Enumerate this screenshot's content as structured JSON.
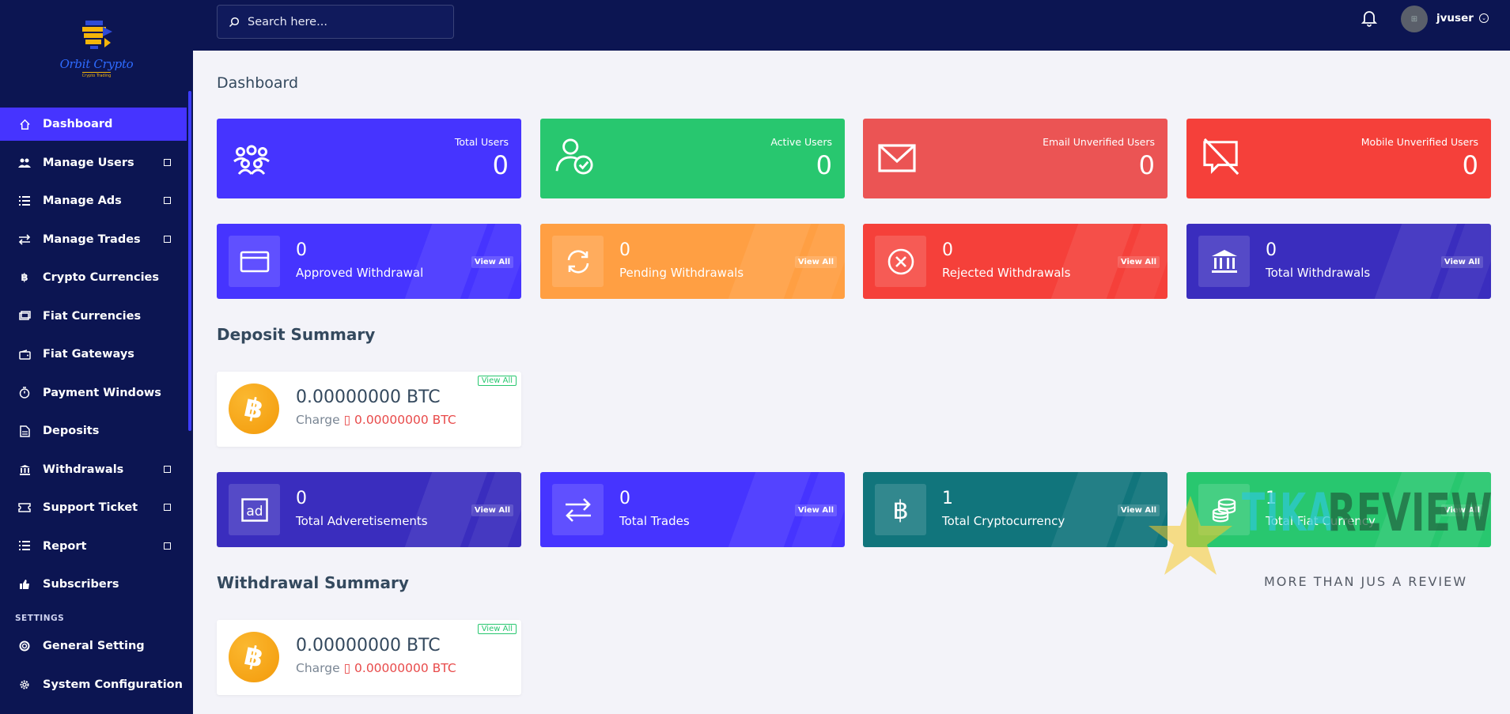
{
  "brand": {
    "name": "Orbit Crypto",
    "tagline": "Crypto Trading"
  },
  "search": {
    "placeholder": "Search here..."
  },
  "user": {
    "name": "jvuser"
  },
  "sidebar": {
    "items": [
      {
        "label": "Dashboard",
        "icon": "home-icon",
        "active": true,
        "has_sub": false
      },
      {
        "label": "Manage Users",
        "icon": "users-icon",
        "has_sub": true
      },
      {
        "label": "Manage Ads",
        "icon": "list-icon",
        "has_sub": true
      },
      {
        "label": "Manage Trades",
        "icon": "exchange-icon",
        "has_sub": true
      },
      {
        "label": "Crypto Currencies",
        "icon": "bitcoin-icon",
        "has_sub": false
      },
      {
        "label": "Fiat Currencies",
        "icon": "money-icon",
        "has_sub": false
      },
      {
        "label": "Fiat Gateways",
        "icon": "wallet-icon",
        "has_sub": false
      },
      {
        "label": "Payment Windows",
        "icon": "stopwatch-icon",
        "has_sub": false
      },
      {
        "label": "Deposits",
        "icon": "file-invoice-icon",
        "has_sub": false
      },
      {
        "label": "Withdrawals",
        "icon": "bank-icon",
        "has_sub": true
      },
      {
        "label": "Support Ticket",
        "icon": "ticket-icon",
        "has_sub": true
      },
      {
        "label": "Report",
        "icon": "list-icon",
        "has_sub": true
      },
      {
        "label": "Subscribers",
        "icon": "thumbs-up-icon",
        "has_sub": false
      }
    ],
    "settings_title": "SETTINGS",
    "settings_items": [
      {
        "label": "General Setting",
        "icon": "life-ring-icon"
      },
      {
        "label": "System Configuration",
        "icon": "cog-icon"
      }
    ]
  },
  "page": {
    "title": "Dashboard"
  },
  "stats": [
    {
      "label": "Total Users",
      "value": "0",
      "color": "#4634ff",
      "icon": "users-group-icon"
    },
    {
      "label": "Active Users",
      "value": "0",
      "color": "#28c76f",
      "icon": "user-check-icon"
    },
    {
      "label": "Email Unverified Users",
      "value": "0",
      "color": "#eb5454",
      "icon": "envelope-icon"
    },
    {
      "label": "Mobile Unverified Users",
      "value": "0",
      "color": "#f5403a",
      "icon": "mobile-slash-icon"
    }
  ],
  "withdraw_stats": [
    {
      "num": "0",
      "label": "Approved Withdrawal",
      "view": "View All",
      "color": "#4634ff",
      "icon": "credit-card-icon"
    },
    {
      "num": "0",
      "label": "Pending Withdrawals",
      "view": "View All",
      "color": "#ff9f43",
      "icon": "sync-icon"
    },
    {
      "num": "0",
      "label": "Rejected Withdrawals",
      "view": "View All",
      "color": "#f5403a",
      "icon": "times-circle-icon"
    },
    {
      "num": "0",
      "label": "Total Withdrawals",
      "view": "View All",
      "color": "#3a2dbe",
      "icon": "bank-icon"
    }
  ],
  "deposit_summary": {
    "title": "Deposit Summary",
    "amount": "0.00000000 BTC",
    "charge_label": "Charge",
    "charge_value": "0.00000000 BTC",
    "view": "View All"
  },
  "misc_stats": [
    {
      "num": "0",
      "label": "Total Adveretisements",
      "view": "View All",
      "color": "#3a2dbe",
      "icon": "ad-icon"
    },
    {
      "num": "0",
      "label": "Total Trades",
      "view": "View All",
      "color": "#4634ff",
      "icon": "exchange-icon"
    },
    {
      "num": "1",
      "label": "Total Cryptocurrency",
      "view": "View All",
      "color": "#11757c",
      "icon": "bitcoin-icon"
    },
    {
      "num": "1",
      "label": "Total Fiat Currency",
      "view": "View All",
      "color": "#28c76f",
      "icon": "coins-icon"
    }
  ],
  "withdrawal_summary": {
    "title": "Withdrawal Summary",
    "amount": "0.00000000 BTC",
    "charge_label": "Charge",
    "charge_value": "0.00000000 BTC",
    "view": "View All"
  },
  "watermark": {
    "word1": "TIKA",
    "word2": "REVIEW",
    "tagline": "MORE THAN JUS A REVIEW"
  }
}
